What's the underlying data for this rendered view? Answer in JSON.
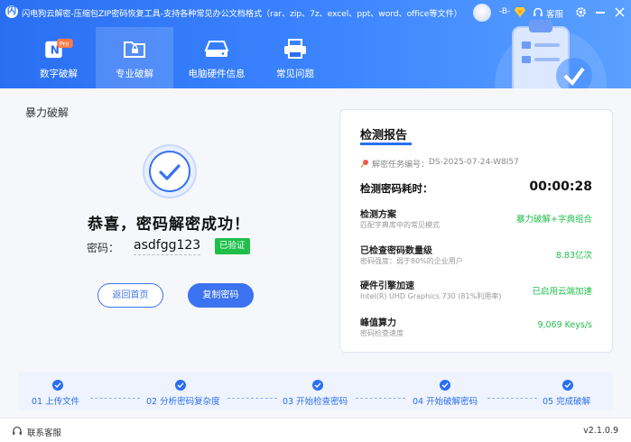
{
  "app": {
    "logo": "闪",
    "title": "闪电狗云解密-压缩包ZIP密码恢复工具-支持各种常见办公文档格式（rar、zip、7z、excel、ppt、word、office等文件）",
    "username": "-B-",
    "service_label": "客服"
  },
  "nav": {
    "items": [
      {
        "label": "数字破解",
        "badge": "Pro",
        "icon": "digit-crack-icon"
      },
      {
        "label": "专业破解",
        "icon": "folder-lock-icon"
      },
      {
        "label": "电脑硬件信息",
        "icon": "hard-drive-icon"
      },
      {
        "label": "常见问题",
        "icon": "printer-icon"
      }
    ],
    "active": 1
  },
  "main": {
    "section_title": "暴力破解",
    "success_msg": "恭喜，密码解密成功！",
    "password_label": "密码：",
    "password_value": "asdfgg123",
    "verified_badge": "已验证",
    "back_button": "返回首页",
    "copy_button": "复制密码"
  },
  "report": {
    "title": "检测报告",
    "task_label": "解密任务编号：",
    "task_id": "DS-2025-07-24-W8I57",
    "time_label": "检测密码耗时：",
    "time_value": "00:00:28",
    "rows": [
      {
        "title": "检测方案",
        "sub": "匹配字典库中的常见模式",
        "value": "暴力破解+字典组合"
      },
      {
        "title": "已检查密码数量级",
        "sub": "密码强度：弱于80%的企业用户",
        "value": "8.83亿次"
      },
      {
        "title": "硬件引擎加速",
        "sub": "Intel(R) UHD Graphics 730 (81%利用率)",
        "value": "已启用云端加速"
      },
      {
        "title": "峰值算力",
        "sub": "密码检查速度",
        "value": "9,069 Keys/s"
      }
    ]
  },
  "steps": [
    {
      "label": "01 上传文件"
    },
    {
      "label": "02 分析密码复杂度"
    },
    {
      "label": "03 开始检查密码"
    },
    {
      "label": "04 开始破解密码"
    },
    {
      "label": "05 完成破解"
    }
  ],
  "footer": {
    "service": "联系客服",
    "version": "v2.1.0.9"
  },
  "colors": {
    "primary": "#2a6ff2",
    "success": "#1fbf4a",
    "accent_pro": "#ff7a45"
  }
}
